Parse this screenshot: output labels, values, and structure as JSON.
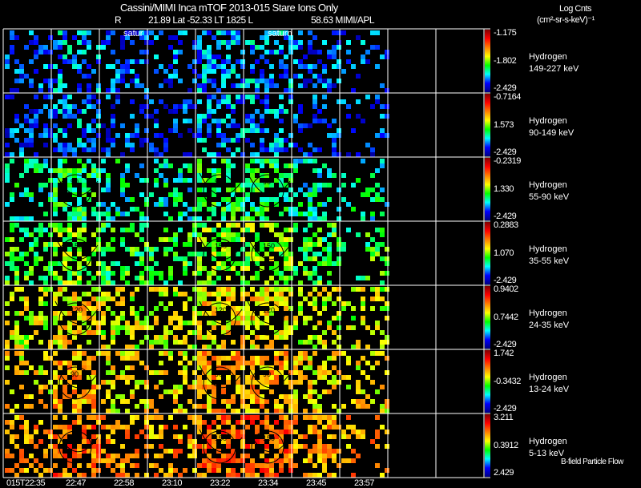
{
  "header": {
    "title": "Cassini/MIMI Inca mTOF  2013-015   Stare   Ions Only",
    "subtitle_r": "R",
    "subtitle_rest": "21.89 Lat -52.33 LT 1825 L",
    "subtitle_l": "58.63  MIMI/APL",
    "units_line1": "Log Cnts",
    "units_line2": "(cm²-sr-s-keV)⁻¹"
  },
  "footer": {
    "legend": "B-field Particle Flow"
  },
  "chart_data": {
    "type": "heatmap",
    "title": "Cassini/MIMI Inca mTOF 2013-015 Stare Ions Only",
    "x_ticks": [
      "015T22:35",
      "22:47",
      "22:58",
      "23:10",
      "23:22",
      "23:34",
      "23:45",
      "23:57"
    ],
    "panel_columns": 10,
    "panel_annotations": [
      {
        "column": 3,
        "text": "satur"
      },
      {
        "column": 6,
        "text": "saturn"
      }
    ],
    "contour_labels": [
      "150",
      "120",
      "90"
    ],
    "colormap": [
      "#000080",
      "#0000ff",
      "#00ffff",
      "#00ff00",
      "#ffff00",
      "#ff8000",
      "#ff0000",
      "#800000"
    ],
    "rows": [
      {
        "species": "Hydrogen",
        "energy": "149-227 keV",
        "max": "-1.175",
        "mid": "-1.802",
        "min": "-2.429",
        "level": 0.18
      },
      {
        "species": "Hydrogen",
        "energy": "90-149 keV",
        "max": "-0.7164",
        "mid": "1.573",
        "min": "-2.429",
        "level": 0.16
      },
      {
        "species": "Hydrogen",
        "energy": "55-90 keV",
        "max": "-0.2319",
        "mid": "1.330",
        "min": "-2.429",
        "level": 0.33
      },
      {
        "species": "Hydrogen",
        "energy": "35-55 keV",
        "max": "0.2883",
        "mid": "1.070",
        "min": "-2.429",
        "level": 0.42
      },
      {
        "species": "Hydrogen",
        "energy": "24-35 keV",
        "max": "0.9402",
        "mid": "0.7442",
        "min": "-2.429",
        "level": 0.55
      },
      {
        "species": "Hydrogen",
        "energy": "13-24 keV",
        "max": "1.742",
        "mid": "-0.3432",
        "min": "-2.429",
        "level": 0.6
      },
      {
        "species": "Hydrogen",
        "energy": "5-13 keV",
        "max": "3.211",
        "mid": "0.3912",
        "min": "2.429",
        "level": 0.68
      }
    ]
  }
}
